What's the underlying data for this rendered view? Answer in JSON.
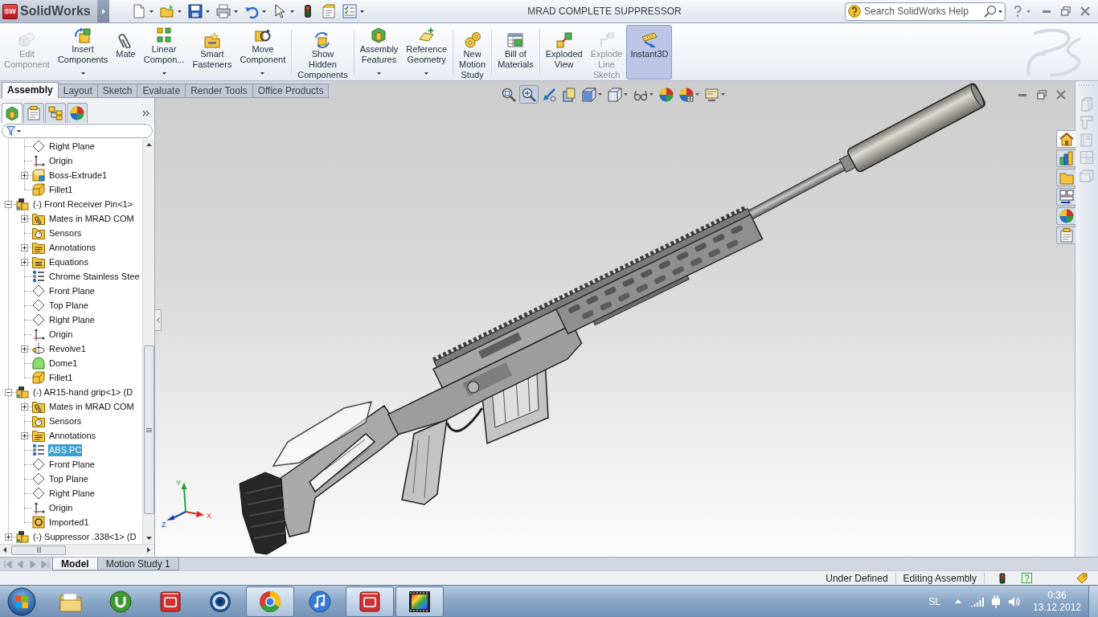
{
  "title_bar": {
    "logo_mark": "SW",
    "app_name": "SolidWorks",
    "document_title": "MRAD COMPLETE SUPPRESSOR",
    "search": {
      "placeholder": "Search SolidWorks Help"
    }
  },
  "command_manager": {
    "groups": [
      [
        {
          "label": "Edit\nComponent",
          "kind": "edit-component",
          "disabled": true,
          "dropdown": false,
          "selected": false
        },
        {
          "label": "Insert\nComponents",
          "kind": "insert-components",
          "disabled": false,
          "dropdown": true,
          "selected": false
        },
        {
          "label": "Mate",
          "kind": "mate",
          "disabled": false,
          "dropdown": false,
          "selected": false
        },
        {
          "label": "Linear\nCompon...",
          "kind": "linear-pattern",
          "disabled": false,
          "dropdown": true,
          "selected": false
        },
        {
          "label": "Smart\nFasteners",
          "kind": "smart-fasteners",
          "disabled": false,
          "dropdown": false,
          "selected": false
        },
        {
          "label": "Move\nComponent",
          "kind": "move-component",
          "disabled": false,
          "dropdown": true,
          "selected": false
        }
      ],
      [
        {
          "label": "Show\nHidden\nComponents",
          "kind": "show-hidden",
          "disabled": false,
          "dropdown": false,
          "selected": false
        }
      ],
      [
        {
          "label": "Assembly\nFeatures",
          "kind": "assembly-features",
          "disabled": false,
          "dropdown": true,
          "selected": false
        },
        {
          "label": "Reference\nGeometry",
          "kind": "reference-geometry",
          "disabled": false,
          "dropdown": true,
          "selected": false
        }
      ],
      [
        {
          "label": "New\nMotion\nStudy",
          "kind": "motion-study",
          "disabled": false,
          "dropdown": false,
          "selected": false
        }
      ],
      [
        {
          "label": "Bill of\nMaterials",
          "kind": "bill-of-materials",
          "disabled": false,
          "dropdown": false,
          "selected": false
        }
      ],
      [
        {
          "label": "Exploded\nView",
          "kind": "exploded-view",
          "disabled": false,
          "dropdown": false,
          "selected": false
        },
        {
          "label": "Explode\nLine\nSketch",
          "kind": "explode-line-sketch",
          "disabled": true,
          "dropdown": false,
          "selected": false
        },
        {
          "label": "Instant3D",
          "kind": "instant3d",
          "disabled": false,
          "dropdown": false,
          "selected": true
        }
      ]
    ]
  },
  "tabs": [
    {
      "label": "Assembly",
      "selected": true
    },
    {
      "label": "Layout",
      "selected": false
    },
    {
      "label": "Sketch",
      "selected": false
    },
    {
      "label": "Evaluate",
      "selected": false
    },
    {
      "label": "Render Tools",
      "selected": false
    },
    {
      "label": "Office Products",
      "selected": false
    }
  ],
  "feature_manager": {
    "panel_tabs": [
      {
        "kind": "feature-manager",
        "selected": true
      },
      {
        "kind": "property-manager",
        "selected": false
      },
      {
        "kind": "configuration-manager",
        "selected": false
      },
      {
        "kind": "display-manager",
        "selected": false
      }
    ],
    "tree": [
      {
        "children": [
          {
            "label": "Right Plane",
            "kind": "plane",
            "selected": false
          },
          {
            "label": "Origin",
            "kind": "origin",
            "selected": false
          },
          {
            "label": "Boss-Extrude1",
            "kind": "boss-extrude",
            "expanded": false,
            "selected": false
          },
          {
            "label": "Fillet1",
            "kind": "fillet",
            "selected": false
          }
        ]
      },
      {
        "label": "(-) Front Receiver Pin<1>",
        "kind": "component",
        "expanded": true,
        "selected": false,
        "children": [
          {
            "label": "Mates in MRAD COM",
            "kind": "mates-folder",
            "expanded": false,
            "selected": false
          },
          {
            "label": "Sensors",
            "kind": "sensors-folder",
            "selected": false
          },
          {
            "label": "Annotations",
            "kind": "annotations-folder",
            "expanded": false,
            "selected": false
          },
          {
            "label": "Equations",
            "kind": "equations-folder",
            "expanded": false,
            "selected": false
          },
          {
            "label": "Chrome Stainless Stee",
            "kind": "material",
            "selected": false
          },
          {
            "label": "Front Plane",
            "kind": "plane",
            "selected": false
          },
          {
            "label": "Top Plane",
            "kind": "plane",
            "selected": false
          },
          {
            "label": "Right Plane",
            "kind": "plane",
            "selected": false
          },
          {
            "label": "Origin",
            "kind": "origin",
            "selected": false
          },
          {
            "label": "Revolve1",
            "kind": "revolve",
            "expanded": false,
            "selected": false
          },
          {
            "label": "Dome1",
            "kind": "dome",
            "selected": false
          },
          {
            "label": "Fillet1",
            "kind": "fillet",
            "selected": false
          }
        ]
      },
      {
        "label": "(-) AR15-hand grip<1> (D",
        "kind": "component",
        "expanded": true,
        "selected": false,
        "children": [
          {
            "label": "Mates in MRAD COM",
            "kind": "mates-folder",
            "expanded": false,
            "selected": false
          },
          {
            "label": "Sensors",
            "kind": "sensors-folder",
            "selected": false
          },
          {
            "label": "Annotations",
            "kind": "annotations-folder",
            "expanded": false,
            "selected": false
          },
          {
            "label": "ABS PC",
            "kind": "material",
            "selected": true
          },
          {
            "label": "Front Plane",
            "kind": "plane",
            "selected": false
          },
          {
            "label": "Top Plane",
            "kind": "plane",
            "selected": false
          },
          {
            "label": "Right Plane",
            "kind": "plane",
            "selected": false
          },
          {
            "label": "Origin",
            "kind": "origin",
            "selected": false
          },
          {
            "label": "Imported1",
            "kind": "imported",
            "selected": false
          }
        ]
      },
      {
        "label": "(-) Suppressor .338<1> (D",
        "kind": "component",
        "expanded": false,
        "selected": false
      }
    ]
  },
  "viewport": {
    "view_toolbar": [
      {
        "kind": "zoom-fit",
        "pressed": false,
        "dropdown": false
      },
      {
        "kind": "zoom-area",
        "pressed": true,
        "dropdown": false
      },
      {
        "kind": "previous-view",
        "pressed": false,
        "dropdown": false
      },
      {
        "kind": "section-view",
        "pressed": false,
        "dropdown": false
      },
      {
        "kind": "view-orientation",
        "pressed": false,
        "dropdown": true
      },
      {
        "kind": "display-style",
        "pressed": false,
        "dropdown": true
      },
      {
        "kind": "hide-show",
        "pressed": false,
        "dropdown": true
      },
      {
        "kind": "edit-appearance",
        "pressed": false,
        "dropdown": false
      },
      {
        "kind": "apply-scene",
        "pressed": false,
        "dropdown": true
      },
      {
        "kind": "view-settings",
        "pressed": false,
        "dropdown": true
      }
    ],
    "triad": {
      "x_label": "X",
      "y_label": "Y",
      "z_label": "Z"
    }
  },
  "task_pane_tabs": [
    {
      "kind": "home",
      "selected": true
    },
    {
      "kind": "design-library",
      "selected": false
    },
    {
      "kind": "file-explorer",
      "selected": false
    },
    {
      "kind": "view-palette",
      "selected": false
    },
    {
      "kind": "appearances",
      "selected": false
    },
    {
      "kind": "custom-properties",
      "selected": false
    }
  ],
  "model_tabs": [
    {
      "label": "Model",
      "selected": true
    },
    {
      "label": "Motion Study 1",
      "selected": false
    }
  ],
  "status_bar": {
    "fields": [
      "Under Defined",
      "Editing Assembly"
    ]
  },
  "taskbar": {
    "apps": [
      {
        "kind": "file-explorer",
        "running": false
      },
      {
        "kind": "torrent",
        "running": false
      },
      {
        "kind": "cad",
        "running": false
      },
      {
        "kind": "ring-app",
        "running": false
      },
      {
        "kind": "browser",
        "running": true
      },
      {
        "kind": "music",
        "running": false
      },
      {
        "kind": "cad",
        "running": true
      },
      {
        "kind": "film",
        "running": true
      }
    ],
    "tray": {
      "language": "SL",
      "time": "0:36",
      "date": "13.12.2012"
    }
  }
}
